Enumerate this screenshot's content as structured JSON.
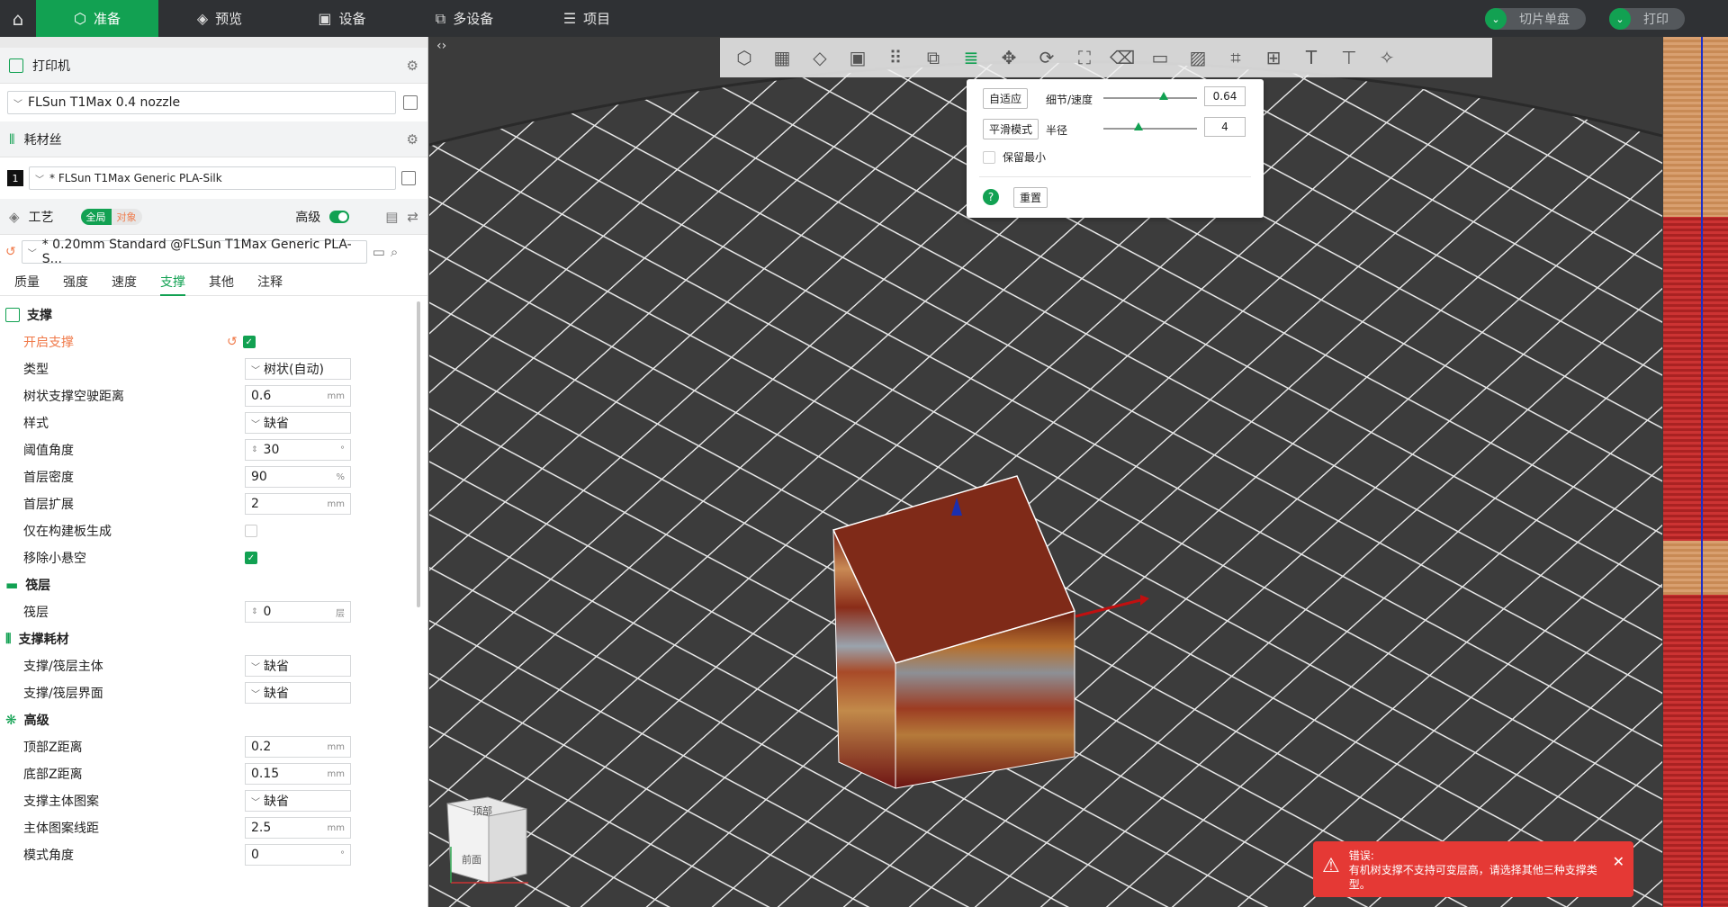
{
  "tabs": [
    {
      "label": "准备",
      "icon": "cube-icon",
      "active": true
    },
    {
      "label": "预览",
      "icon": "layers-icon",
      "active": false
    },
    {
      "label": "设备",
      "icon": "device-icon",
      "active": false
    },
    {
      "label": "多设备",
      "icon": "multi-device-icon",
      "active": false
    },
    {
      "label": "项目",
      "icon": "project-icon",
      "active": false
    }
  ],
  "top_actions": {
    "slice_label": "切片单盘",
    "print_label": "打印"
  },
  "printer": {
    "section_title": "打印机",
    "selected": "FLSun T1Max 0.4 nozzle"
  },
  "filament": {
    "section_title": "耗材丝",
    "index": "1",
    "selected": "* FLSun T1Max Generic PLA-Silk"
  },
  "process": {
    "section_title": "工艺",
    "scope_global": "全局",
    "scope_object": "对象",
    "advanced_label": "高级",
    "preset": "* 0.20mm Standard @FLSun T1Max Generic PLA-S..."
  },
  "subtabs": [
    {
      "label": "质量",
      "active": false
    },
    {
      "label": "强度",
      "active": false
    },
    {
      "label": "速度",
      "active": false
    },
    {
      "label": "支撑",
      "active": true
    },
    {
      "label": "其他",
      "active": false
    },
    {
      "label": "注释",
      "active": false
    }
  ],
  "groups": {
    "support": "支撑",
    "raft": "筏层",
    "support_filament": "支撑耗材",
    "advanced": "高级"
  },
  "options": {
    "enable_support": {
      "label": "开启支撑",
      "checked": true
    },
    "type": {
      "label": "类型",
      "value": "树状(自动)"
    },
    "tree_avoid": {
      "label": "树状支撑空驶距离",
      "value": "0.6",
      "unit": "mm"
    },
    "style": {
      "label": "样式",
      "value": "缺省"
    },
    "threshold": {
      "label": "阈值角度",
      "value": "30",
      "unit": "°"
    },
    "first_density": {
      "label": "首层密度",
      "value": "90",
      "unit": "%"
    },
    "first_expand": {
      "label": "首层扩展",
      "value": "2",
      "unit": "mm"
    },
    "buildplate_only": {
      "label": "仅在构建板生成",
      "checked": false
    },
    "remove_small": {
      "label": "移除小悬空",
      "checked": true
    },
    "raft_layers": {
      "label": "筏层",
      "value": "0",
      "unit": "层"
    },
    "support_base": {
      "label": "支撑/筏层主体",
      "value": "缺省"
    },
    "support_iface": {
      "label": "支撑/筏层界面",
      "value": "缺省"
    },
    "top_z": {
      "label": "顶部Z距离",
      "value": "0.2",
      "unit": "mm"
    },
    "bottom_z": {
      "label": "底部Z距离",
      "value": "0.15",
      "unit": "mm"
    },
    "base_pattern": {
      "label": "支撑主体图案",
      "value": "缺省"
    },
    "pattern_spacing": {
      "label": "主体图案线距",
      "value": "2.5",
      "unit": "mm"
    },
    "pattern_angle": {
      "label": "模式角度",
      "value": "0",
      "unit": "°"
    }
  },
  "popup": {
    "adaptive_label": "自适应",
    "detail_label": "细节/速度",
    "detail_value": "0.64",
    "detail_level": 0.64,
    "smooth_label": "平滑模式",
    "radius_label": "半径",
    "radius_value": "4",
    "keep_min_label": "保留最小",
    "reset_label": "重置"
  },
  "toast": {
    "title": "错误:",
    "message": "有机树支撑不支持可变层高，请选择其他三种支撑类型。"
  },
  "cube_labels": {
    "top": "顶部",
    "front": "前面"
  },
  "colors": {
    "accent": "#12a152",
    "error": "#e53935"
  }
}
